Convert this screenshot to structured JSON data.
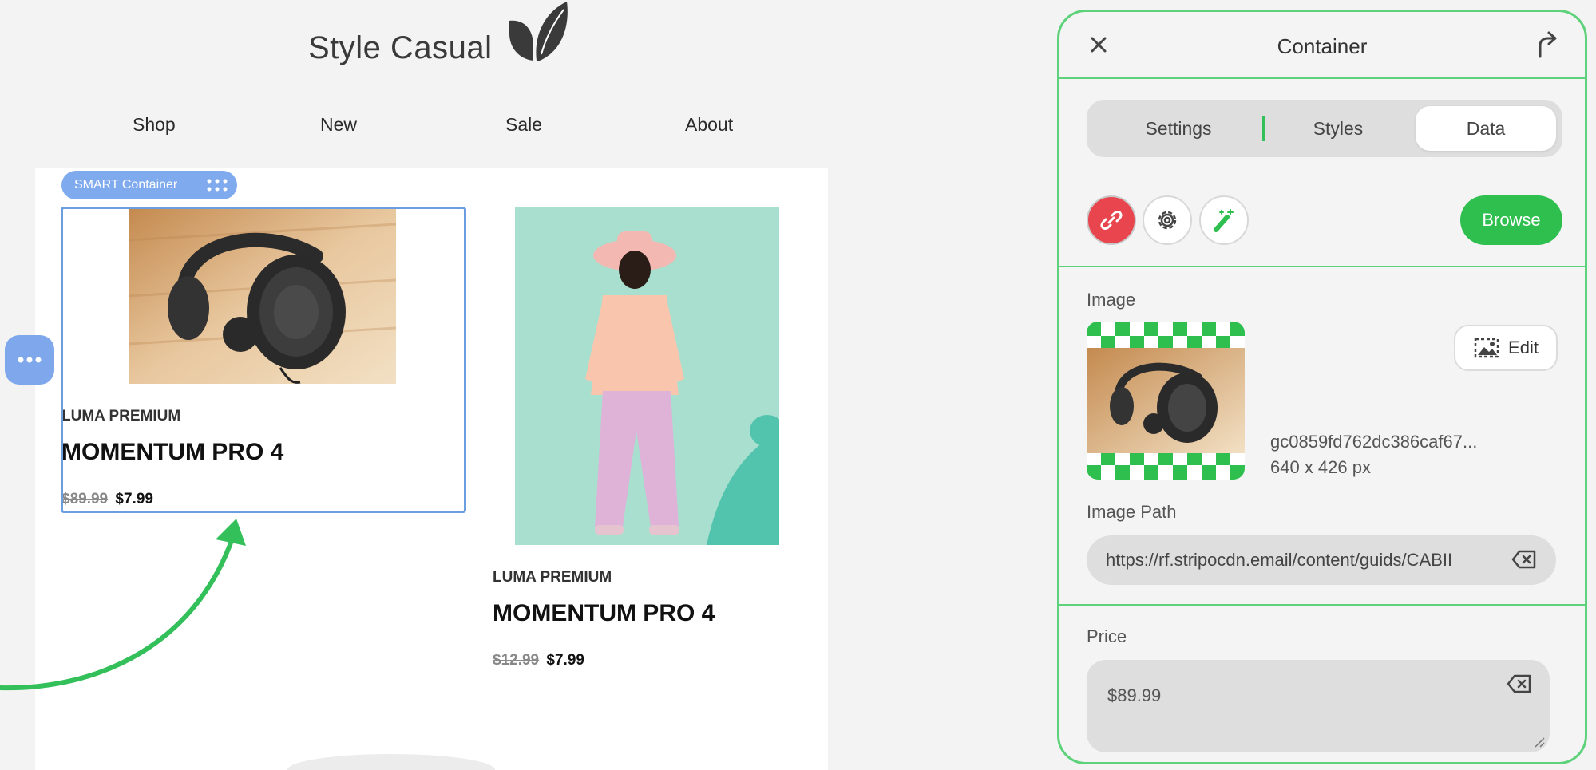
{
  "brand": {
    "name": "Style Casual"
  },
  "nav": {
    "items": [
      "Shop",
      "New",
      "Sale",
      "About"
    ]
  },
  "smart_badge": {
    "label": "SMART Container"
  },
  "products": [
    {
      "brand": "LUMA PREMIUM",
      "title": "MOMENTUM PRO 4",
      "old_price": "$89.99",
      "new_price": "$7.99"
    },
    {
      "brand": "LUMA PREMIUM",
      "title": "MOMENTUM PRO 4",
      "old_price": "$12.99",
      "new_price": "$7.99"
    }
  ],
  "panel": {
    "title": "Container",
    "tabs": [
      "Settings",
      "Styles",
      "Data"
    ],
    "active_tab": "Data",
    "browse_label": "Browse",
    "image_label": "Image",
    "edit_label": "Edit",
    "file_name": "gc0859fd762dc386caf67...",
    "file_size": "640 x 426 px",
    "image_path_label": "Image Path",
    "image_path_value": "https://rf.stripocdn.email/content/guids/CABII",
    "price_label": "Price",
    "price_value": "$89.99"
  },
  "colors": {
    "accent_green": "#2ebf4f",
    "panel_border": "#5ed27a",
    "unlink_red": "#e9454f",
    "selection_blue": "#6a9ee0",
    "badge_blue": "#80aaee"
  },
  "icons": [
    "leaf-logo-icon",
    "drag-grid-icon",
    "more-dots-icon",
    "close-icon",
    "share-icon",
    "unlink-icon",
    "gear-icon",
    "magic-wand-icon",
    "image-edit-icon",
    "backspace-clear-icon",
    "resize-handle-icon"
  ]
}
